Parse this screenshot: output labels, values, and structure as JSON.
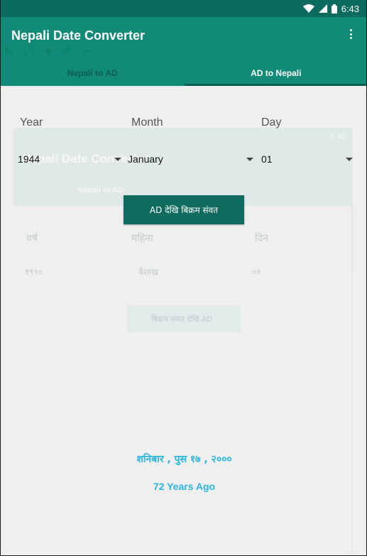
{
  "status_bar": {
    "time": "6:43"
  },
  "app_bar": {
    "title": "Nepali Date Converter"
  },
  "tabs": [
    {
      "label": "Nepali to AD",
      "active": false
    },
    {
      "label": "AD to Nepali",
      "active": true
    }
  ],
  "form": {
    "year_label": "Year",
    "month_label": "Month",
    "day_label": "Day",
    "year_value": "1944",
    "month_value": "January",
    "day_value": "01",
    "convert_button": "AD देखि बिक्रम संवत"
  },
  "result": {
    "nepali_date": "शनिबार  , पुस  १७ , २०००",
    "years_ago": "72 Years Ago"
  },
  "ghost": {
    "time": "6:42",
    "title": "Nepali Date Converter",
    "tab": "Nepali to AD",
    "year_label": "वर्ष",
    "month_label": "महिना",
    "day_label": "दिन",
    "year_value": "१९९०",
    "month_value": "बैशाख",
    "day_value": "०१",
    "button": "बिक्रम संवत देखि AD"
  },
  "colors": {
    "primary": "#128a78",
    "primary_dark": "#0b6b5e",
    "button": "#0e6b5d",
    "result_text": "#2bb4e0"
  }
}
